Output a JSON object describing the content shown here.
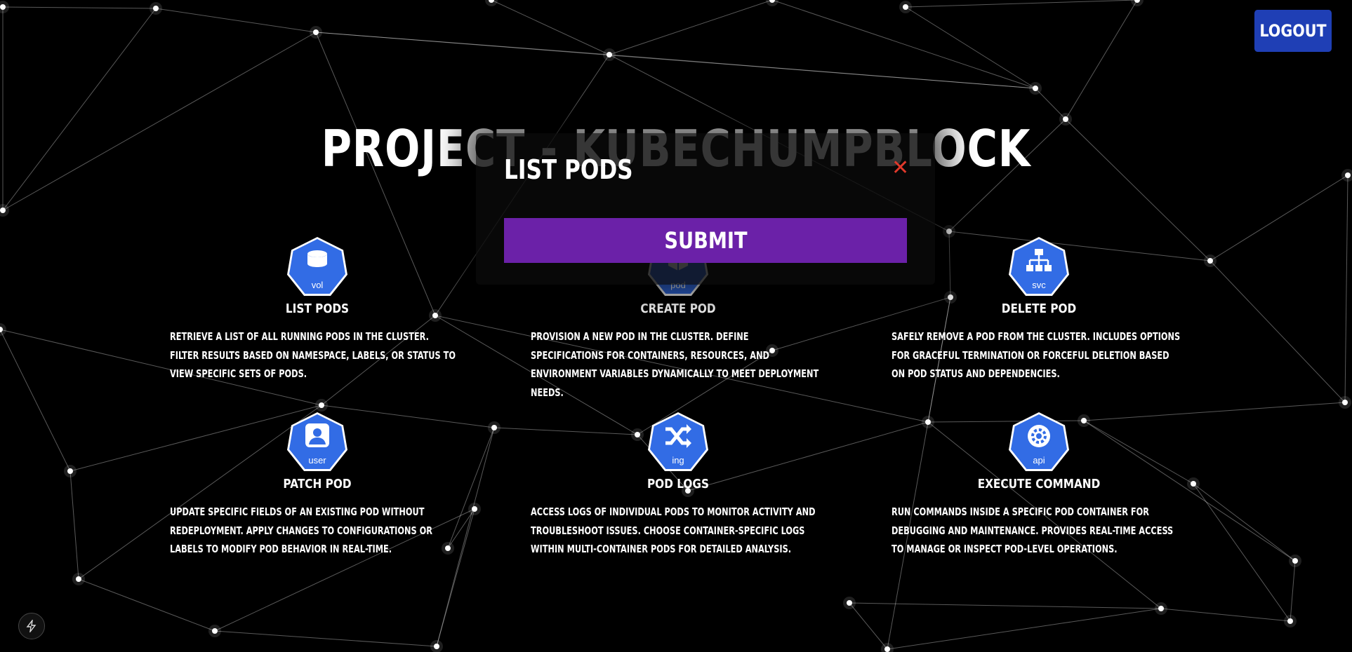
{
  "header": {
    "logout_label": "LOGOUT"
  },
  "page": {
    "title": "PROJECT - KUBECHUMPBLOCK"
  },
  "cards": [
    {
      "icon": "database-icon",
      "badge": "vol",
      "title": "LIST PODS",
      "description": "RETRIEVE A LIST OF ALL RUNNING PODS IN THE CLUSTER. FILTER RESULTS BASED ON NAMESPACE, LABELS, OR STATUS TO VIEW SPECIFIC SETS OF PODS."
    },
    {
      "icon": "cube-icon",
      "badge": "pod",
      "title": "CREATE POD",
      "description": "PROVISION A NEW POD IN THE CLUSTER. DEFINE SPECIFICATIONS FOR CONTAINERS, RESOURCES, AND ENVIRONMENT VARIABLES DYNAMICALLY TO MEET DEPLOYMENT NEEDS."
    },
    {
      "icon": "hierarchy-icon",
      "badge": "svc",
      "title": "DELETE POD",
      "description": "SAFELY REMOVE A POD FROM THE CLUSTER. INCLUDES OPTIONS FOR GRACEFUL TERMINATION OR FORCEFUL DELETION BASED ON POD STATUS AND DEPENDENCIES."
    },
    {
      "icon": "user-icon",
      "badge": "user",
      "title": "PATCH POD",
      "description": "UPDATE SPECIFIC FIELDS OF AN EXISTING POD WITHOUT REDEPLOYMENT. APPLY CHANGES TO CONFIGURATIONS OR LABELS TO MODIFY POD BEHAVIOR IN REAL-TIME."
    },
    {
      "icon": "shuffle-icon",
      "badge": "ing",
      "title": "POD LOGS",
      "description": "ACCESS LOGS OF INDIVIDUAL PODS TO MONITOR ACTIVITY AND TROUBLESHOOT ISSUES. CHOOSE CONTAINER-SPECIFIC LOGS WITHIN MULTI-CONTAINER PODS FOR DETAILED ANALYSIS."
    },
    {
      "icon": "gear-icon",
      "badge": "api",
      "title": "EXECUTE COMMAND",
      "description": "RUN COMMANDS INSIDE A SPECIFIC POD CONTAINER FOR DEBUGGING AND MAINTENANCE. PROVIDES REAL-TIME ACCESS TO MANAGE OR INSPECT POD-LEVEL OPERATIONS."
    }
  ],
  "modal": {
    "title": "LIST PODS",
    "close_icon": "close-icon",
    "submit_label": "SUBMIT"
  },
  "corner": {
    "icon": "lightning-icon"
  },
  "colors": {
    "accent_blue": "#326ce5",
    "logout": "#1f3fb5",
    "submit": "#6b21a8",
    "close": "#e0392b"
  }
}
